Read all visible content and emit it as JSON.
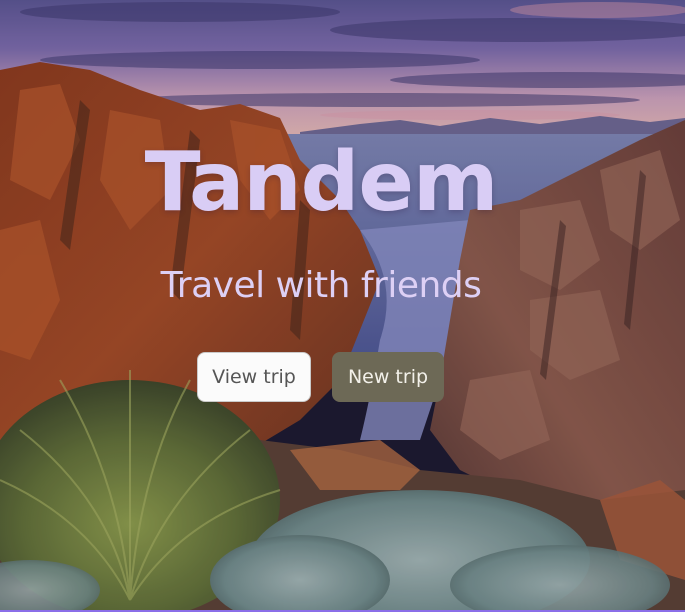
{
  "app": {
    "title": "Tandem",
    "tagline": "Travel with friends"
  },
  "actions": {
    "view_trip_label": "View trip",
    "new_trip_label": "New trip"
  },
  "theme": {
    "title_color": "#d9cdf5",
    "primary_button_color": "#6d6956",
    "secondary_button_color": "#fbfbfb",
    "accent_rule_color": "#8a6ee8"
  },
  "background": {
    "icon": "coastal-rocks-sunset-landscape"
  }
}
